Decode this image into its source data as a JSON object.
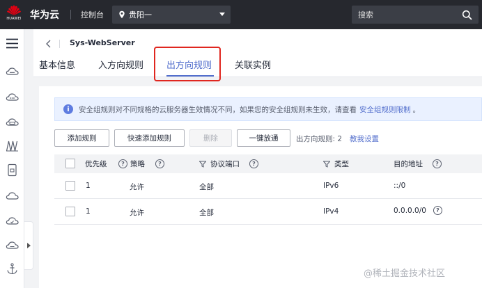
{
  "topbar": {
    "brand": "华为云",
    "logo_text": "HUAWEI",
    "console": "控制台",
    "region": "贵阳一",
    "search_placeholder": "搜索"
  },
  "header": {
    "title": "Sys-WebServer",
    "tabs": [
      {
        "label": "基本信息",
        "active": false
      },
      {
        "label": "入方向规则",
        "active": false
      },
      {
        "label": "出方向规则",
        "active": true
      },
      {
        "label": "关联实例",
        "active": false
      }
    ]
  },
  "notice": {
    "text": "安全组规则对不同规格的云服务器生效情况不同，如果您的安全组规则未生效，请查看",
    "link": "安全组规则限制",
    "period": "。"
  },
  "toolbar": {
    "add_rule": "添加规则",
    "quick_add_rule": "快速添加规则",
    "delete": "删除",
    "one_click_allow": "一键放通",
    "rule_count_label": "出方向规则: 2",
    "teach_link": "教我设置"
  },
  "table": {
    "headers": {
      "priority": "优先级",
      "policy": "策略",
      "protocol_port": "协议端口",
      "type": "类型",
      "destination": "目的地址"
    },
    "rows": [
      {
        "priority": "1",
        "policy": "允许",
        "protocol_port": "全部",
        "type": "IPv6",
        "destination": "::/0"
      },
      {
        "priority": "1",
        "policy": "允许",
        "protocol_port": "全部",
        "type": "IPv4",
        "destination": "0.0.0.0/0"
      }
    ]
  },
  "watermark": "@稀土掘金技术社区",
  "colors": {
    "topbar": "#26282e",
    "accent": "#526ecc",
    "highlight": "#e0261f",
    "huawei_red": "#c7000b"
  }
}
